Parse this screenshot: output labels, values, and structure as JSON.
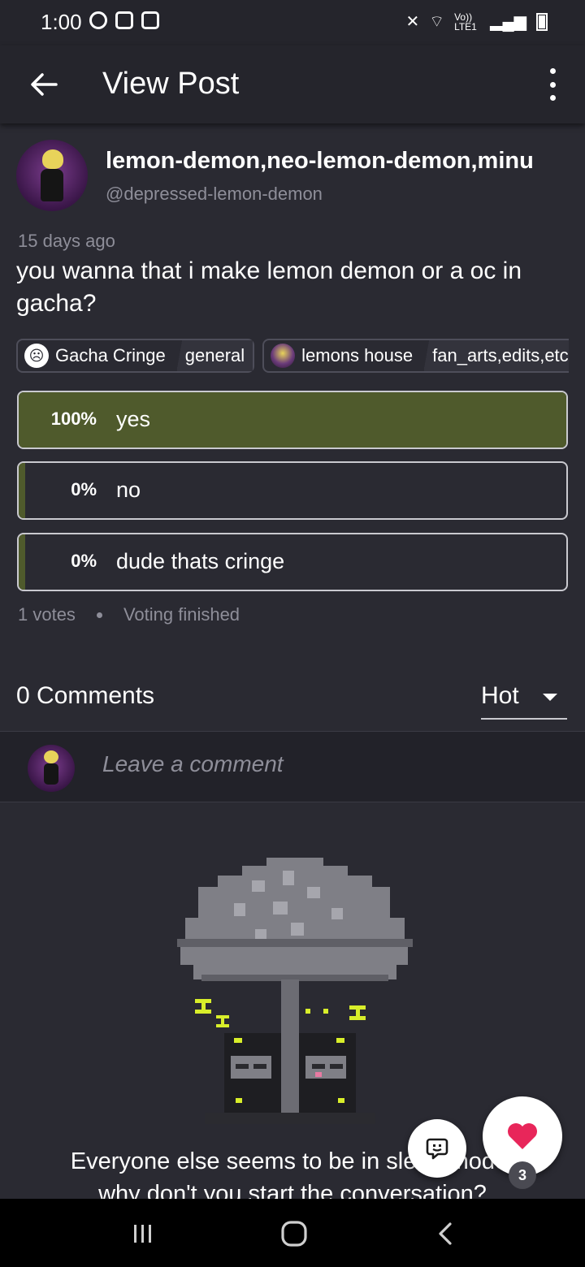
{
  "status_bar": {
    "time": "1:00",
    "network_label": "Vo)) LTE1"
  },
  "app_bar": {
    "title": "View Post"
  },
  "post": {
    "author_name": "lemon-demon,neo-lemon-demon,minu",
    "author_handle": "@depressed-lemon-demon",
    "time_ago": "15 days ago",
    "title": "you wanna that i make lemon demon or a oc in gacha?",
    "tags": [
      {
        "community": "Gacha Cringe",
        "category": "general",
        "icon": "sad-face-icon"
      },
      {
        "community": "lemons house",
        "category": "fan_arts,edits,etc",
        "icon": "community-avatar-icon"
      }
    ],
    "poll": {
      "options": [
        {
          "percent": "100%",
          "label": "yes",
          "fraction": 1.0
        },
        {
          "percent": "0%",
          "label": "no",
          "fraction": 0.0
        },
        {
          "percent": "0%",
          "label": "dude thats cringe",
          "fraction": 0.0
        }
      ],
      "votes": "1 votes",
      "status": "Voting finished"
    }
  },
  "comments": {
    "count_label": "0 Comments",
    "sort_value": "Hot",
    "input_placeholder": "Leave a comment",
    "empty_message_line1": "Everyone else seems to be in sleep mode,",
    "empty_message_line2": "why don't you start the conversation?"
  },
  "fab": {
    "like_count": "3"
  },
  "colors": {
    "background": "#2a2a32",
    "poll_fill": "#4f5a2c",
    "like_heart": "#e8265a"
  }
}
